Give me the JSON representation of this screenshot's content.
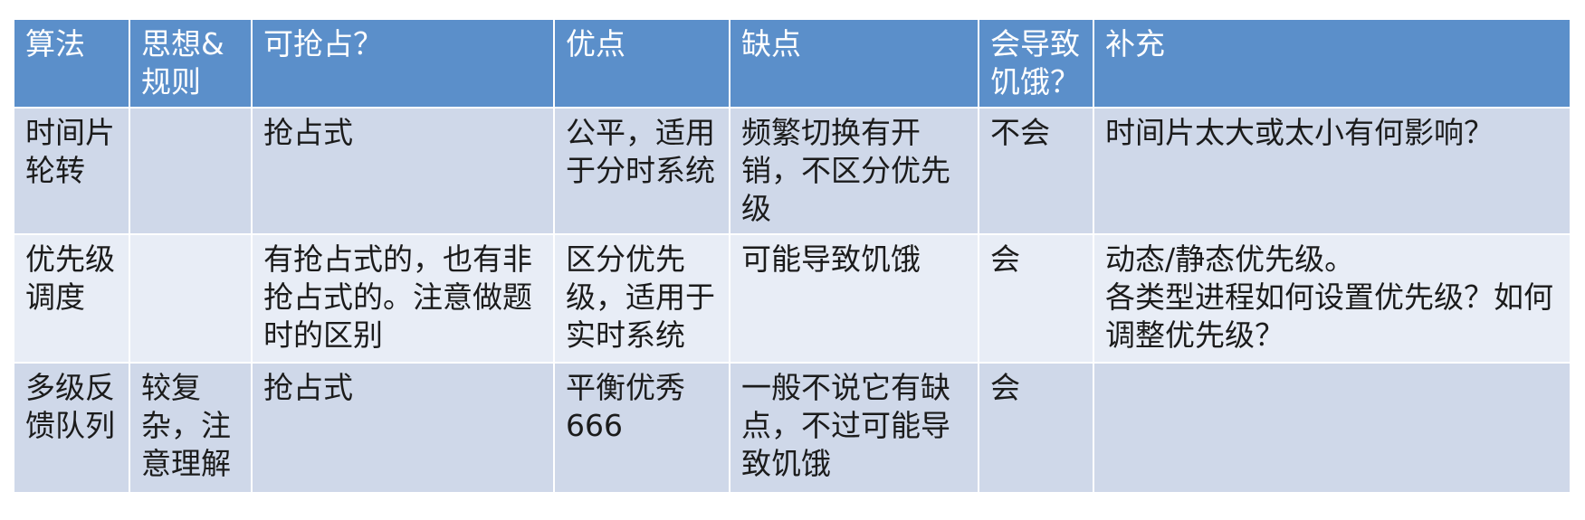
{
  "table": {
    "headers": [
      "算法",
      "思想&规则",
      "可抢占？",
      "优点",
      "缺点",
      "会导致饥饿？",
      "补充"
    ],
    "rows": [
      {
        "algorithm": "时间片轮转",
        "idea_rules": "",
        "preemptive": "抢占式",
        "pros": "公平，适用于分时系统",
        "cons": "频繁切换有开销，不区分优先级",
        "starvation": "不会",
        "notes": "时间片太大或太小有何影响？"
      },
      {
        "algorithm": "优先级调度",
        "idea_rules": "",
        "preemptive": "有抢占式的，也有非抢占式的。注意做题时的区别",
        "pros": "区分优先级，适用于实时系统",
        "cons": "可能导致饥饿",
        "starvation": "会",
        "notes_line1": "动态/静态优先级。",
        "notes_line2": "各类型进程如何设置优先级？如何调整优先级？"
      },
      {
        "algorithm": "多级反馈队列",
        "idea_rules": "较复杂，注意理解",
        "preemptive": "抢占式",
        "pros_line1": "平衡优秀",
        "pros_line2": "666",
        "cons": "一般不说它有缺点，不过可能导致饥饿",
        "starvation": "会",
        "notes": ""
      }
    ]
  },
  "colors": {
    "header_bg": "#5b8fca",
    "row_odd_bg": "#cfd8e9",
    "row_even_bg": "#e8edf6",
    "border": "#ffffff"
  }
}
